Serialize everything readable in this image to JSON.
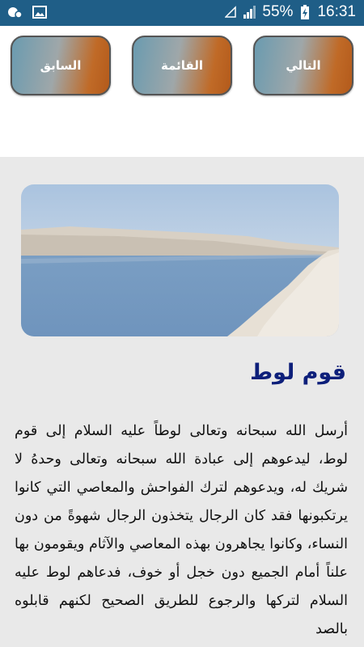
{
  "status_bar": {
    "battery_percent": "55%",
    "time": "16:31",
    "icons": [
      "mail-notification-icon",
      "image-notification-icon",
      "wifi-icon",
      "signal-icon",
      "battery-charging-icon"
    ]
  },
  "nav": {
    "next_label": "التالي",
    "list_label": "القائمة",
    "previous_label": "السابق",
    "button_gradient": [
      "#6a9bb0",
      "#b35a1b"
    ]
  },
  "article": {
    "title": "قوم لوط",
    "title_color": "#0d1f7a",
    "body": "أرسل الله سبحانه وتعالى لوطاً عليه السلام إلى قوم لوط، ليدعوهم إلى عبادة الله سبحانه وتعالى وحدهُ لا شريك له، ويدعوهم لترك الفواحش والمعاصي التي كانوا يرتكبونها فقد كان الرجال يتخذون الرجال شهوةً من دون النساء، وكانوا يجاهرون بهذه المعاصي والآثام ويقومون بها علناً أمام الجميع دون خجل أو خوف، فدعاهم لوط عليه السلام لتركها والرجوع للطريق الصحيح لكنهم قابلوه بالصد"
  },
  "image": {
    "subject": "sea-shore-photo"
  }
}
